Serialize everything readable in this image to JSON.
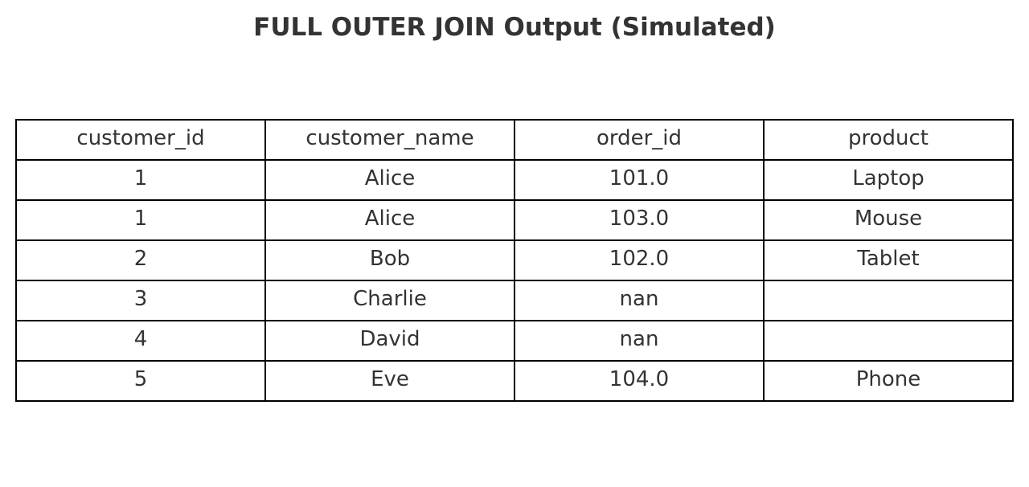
{
  "chart_data": {
    "type": "table",
    "title": "FULL OUTER JOIN Output (Simulated)",
    "columns": [
      "customer_id",
      "customer_name",
      "order_id",
      "product"
    ],
    "rows": [
      [
        "1",
        "Alice",
        "101.0",
        "Laptop"
      ],
      [
        "1",
        "Alice",
        "103.0",
        "Mouse"
      ],
      [
        "2",
        "Bob",
        "102.0",
        "Tablet"
      ],
      [
        "3",
        "Charlie",
        "nan",
        ""
      ],
      [
        "4",
        "David",
        "nan",
        ""
      ],
      [
        "5",
        "Eve",
        "104.0",
        "Phone"
      ]
    ]
  }
}
